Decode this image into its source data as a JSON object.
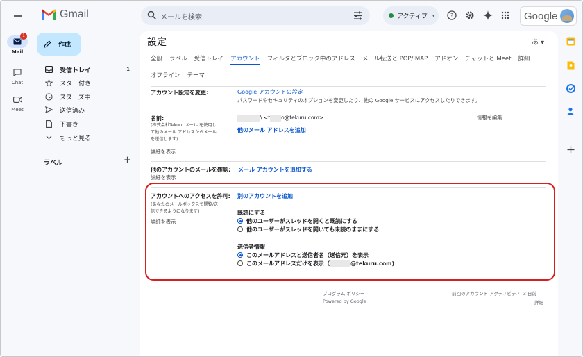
{
  "app": {
    "name": "Gmail"
  },
  "search": {
    "placeholder": "メールを検索"
  },
  "status": {
    "label": "アクティブ"
  },
  "google_label": "Google",
  "rail": {
    "mail": {
      "label": "Mail",
      "badge": "1"
    },
    "chat": {
      "label": "Chat"
    },
    "meet": {
      "label": "Meet"
    }
  },
  "nav": {
    "compose_label": "作成",
    "items": [
      {
        "label": "受信トレイ",
        "count": "1"
      },
      {
        "label": "スター付き"
      },
      {
        "label": "スヌーズ中"
      },
      {
        "label": "送信済み"
      },
      {
        "label": "下書き"
      },
      {
        "label": "もっと見る"
      }
    ],
    "labels_heading": "ラベル",
    "labels_add": "+"
  },
  "main": {
    "title": "設定",
    "lang": "あ ▾",
    "tabs_row1": [
      "全般",
      "ラベル",
      "受信トレイ",
      "アカウント",
      "フィルタとブロック中のアドレス",
      "メール転送と POP/IMAP",
      "アドオン",
      "チャットと Meet",
      "詳細"
    ],
    "tabs_row2": [
      "オフライン",
      "テーマ"
    ],
    "active_tab": "アカウント"
  },
  "sections": {
    "change_account": {
      "label": "アカウント設定を変更:",
      "link": "Google アカウントの設定",
      "desc": "パスワードやセキュリティのオプションを変更したり、他の Google サービスにアクセスしたりできます。"
    },
    "name": {
      "label": "名前:",
      "sub": "(株式会社Tekuru メール を使用して他のメール アドレスからメールを送信します)",
      "details": "詳細を表示",
      "sender_prefix": "\\ <t",
      "sender_suffix": "o@tekuru.com>",
      "add_link": "他のメール アドレスを追加",
      "edit_link": "情報を編集"
    },
    "check_mail": {
      "label": "他のアカウントのメールを確認:",
      "link": "メール アカウントを追加する",
      "details": "詳細を表示"
    },
    "grant_access": {
      "label": "アカウントへのアクセスを許可:",
      "sub": "(あなたのメールボックスで閲覧/送信できるようになります)",
      "details": "詳細を表示",
      "add_link": "別のアカウントを追加",
      "read_heading": "既読にする",
      "read_options": [
        "他のユーザーがスレッドを開くと既読にする",
        "他のユーザーがスレッドを開いても未読のままにする"
      ],
      "sender_heading": "送信者情報",
      "sender_options": [
        "このメールアドレスと送信者名（送信元）を表示",
        "このメールアドレスだけを表示（"
      ],
      "sender_option2_suffix": "@tekuru.com)"
    }
  },
  "footer": {
    "policy": "プログラム ポリシー",
    "powered": "Powered by Google",
    "activity": "前回のアカウント アクティビティ: 3 日前",
    "details": "詳細"
  },
  "colors": {
    "accent": "#0b57d0",
    "highlight": "#d91e1e",
    "compose": "#c2e7ff"
  }
}
